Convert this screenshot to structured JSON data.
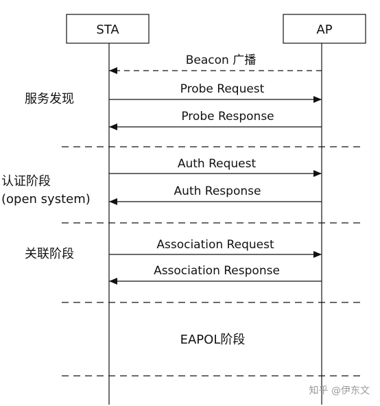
{
  "participants": {
    "sta": "STA",
    "ap": "AP"
  },
  "phases": {
    "discovery": "服务发现",
    "auth_line1": "认证阶段",
    "auth_line2": "(open system)",
    "association": "关联阶段",
    "eapol": "EAPOL阶段"
  },
  "messages": {
    "beacon": "Beacon 广播",
    "probe_request": "Probe Request",
    "probe_response": "Probe Response",
    "auth_request": "Auth Request",
    "auth_response": "Auth Response",
    "assoc_request": "Association Request",
    "assoc_response": "Association Response"
  },
  "watermark": "知乎 @伊东文"
}
